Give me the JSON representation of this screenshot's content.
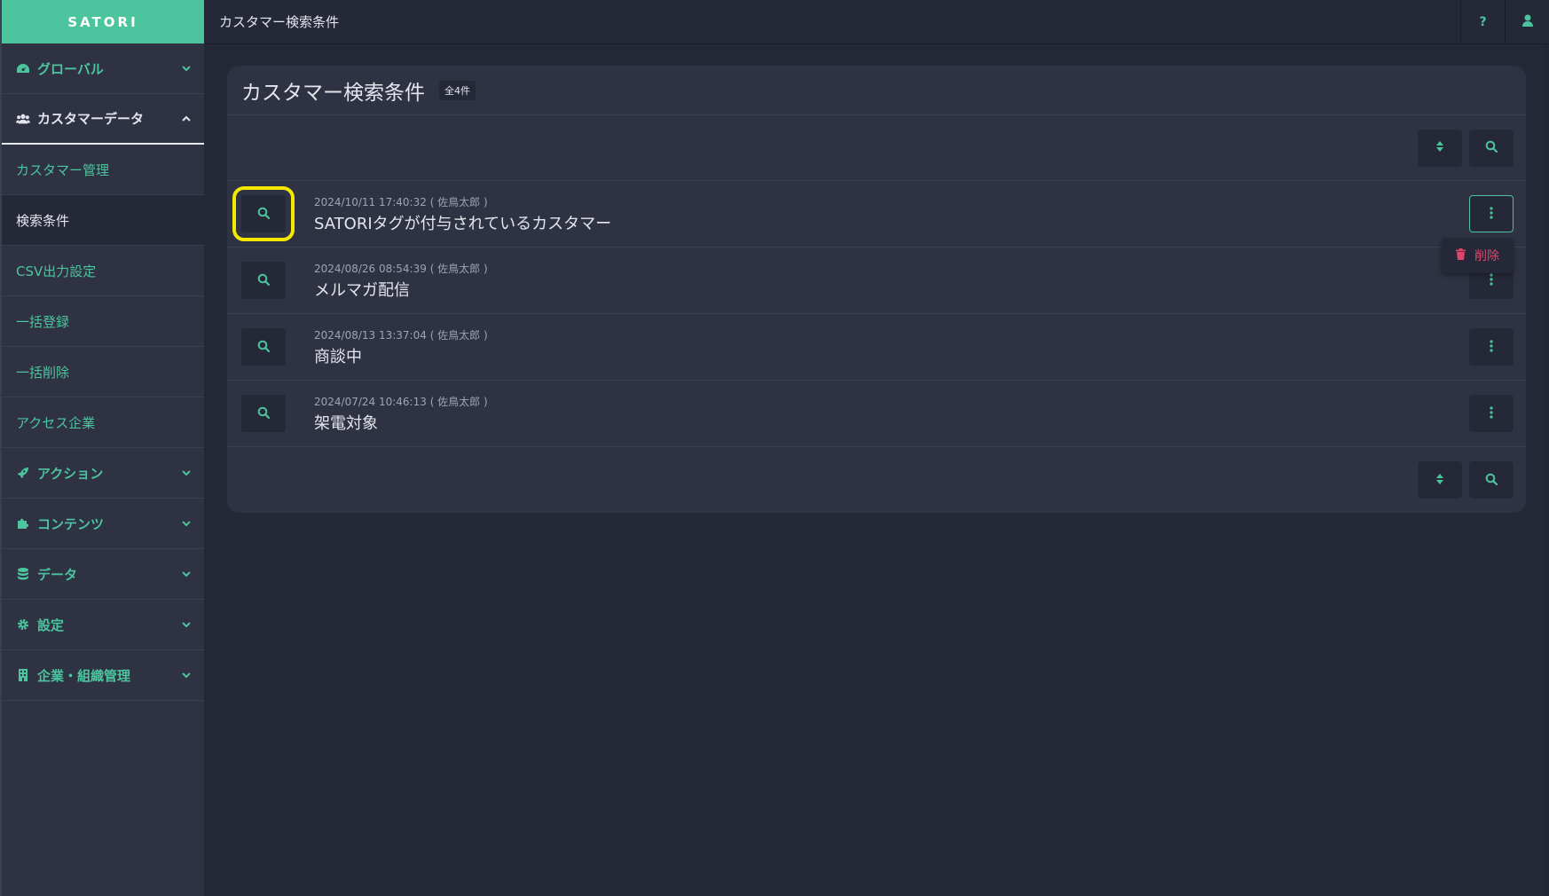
{
  "brand": "SATORI",
  "header": {
    "title": "カスタマー検索条件",
    "help_label": "?"
  },
  "sidebar": {
    "groups": [
      {
        "label": "グローバル",
        "icon": "dashboard-icon"
      },
      {
        "label": "カスタマーデータ",
        "icon": "users-icon",
        "open": true
      },
      {
        "label": "アクション",
        "icon": "rocket-icon"
      },
      {
        "label": "コンテンツ",
        "icon": "puzzle-icon"
      },
      {
        "label": "データ",
        "icon": "database-icon"
      },
      {
        "label": "設定",
        "icon": "gear-icon"
      },
      {
        "label": "企業・組織管理",
        "icon": "building-icon"
      }
    ],
    "sub_items": [
      {
        "label": "カスタマー管理"
      },
      {
        "label": "検索条件",
        "active": true
      },
      {
        "label": "CSV出力設定"
      },
      {
        "label": "一括登録"
      },
      {
        "label": "一括削除"
      },
      {
        "label": "アクセス企業"
      }
    ]
  },
  "card": {
    "title": "カスタマー検索条件",
    "count": "全4件"
  },
  "rows": [
    {
      "meta": "2024/10/11 17:40:32 ( 佐鳥太郎 )",
      "name": "SATORIタグが付与されているカスタマー"
    },
    {
      "meta": "2024/08/26 08:54:39 ( 佐鳥太郎 )",
      "name": "メルマガ配信"
    },
    {
      "meta": "2024/08/13 13:37:04 ( 佐鳥太郎 )",
      "name": "商談中"
    },
    {
      "meta": "2024/07/24 10:46:13 ( 佐鳥太郎 )",
      "name": "架電対象"
    }
  ],
  "dropdown": {
    "delete_label": "削除"
  },
  "colors": {
    "accent": "#4cc49e",
    "danger": "#e0446c",
    "highlight": "#f5e800",
    "bg": "#252836",
    "panel": "#2e3242"
  }
}
